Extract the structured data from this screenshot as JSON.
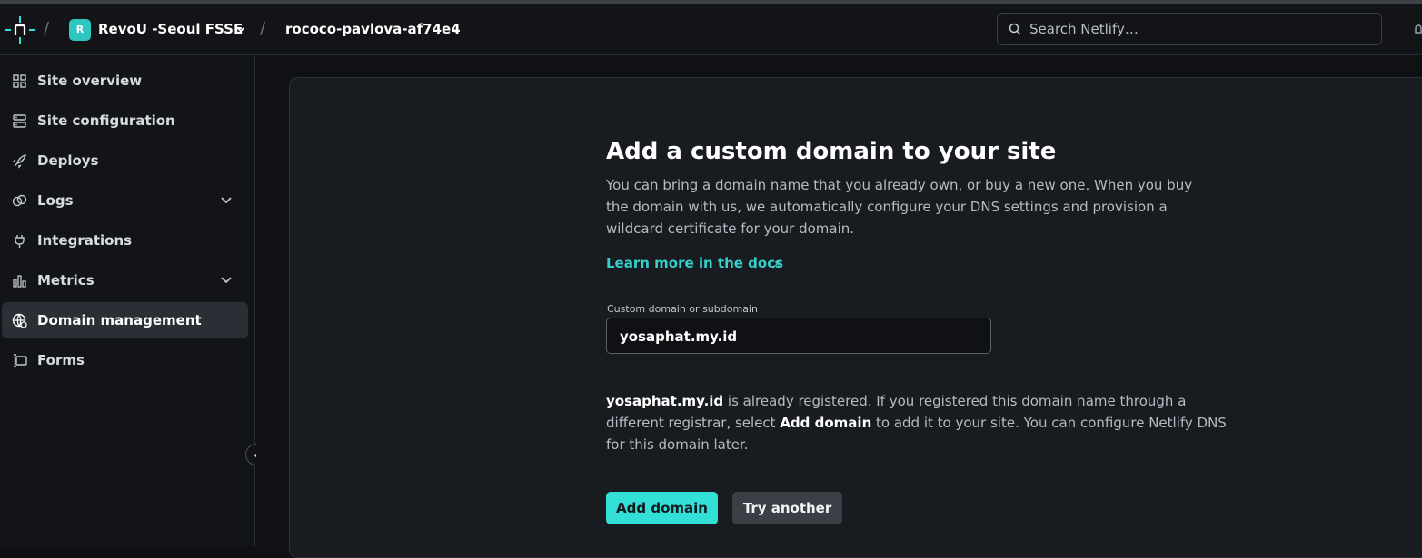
{
  "header": {
    "team_initial": "R",
    "team_name": "RevoU -Seoul FSSE",
    "site_name": "rococo-pavlova-af74e4",
    "search_placeholder": "Search Netlify…"
  },
  "sidebar": {
    "items": [
      {
        "label": "Site overview",
        "icon": "grid-icon"
      },
      {
        "label": "Site configuration",
        "icon": "settings-list-icon"
      },
      {
        "label": "Deploys",
        "icon": "rocket-icon"
      },
      {
        "label": "Logs",
        "icon": "coins-icon",
        "expandable": true
      },
      {
        "label": "Integrations",
        "icon": "plug-icon"
      },
      {
        "label": "Metrics",
        "icon": "bar-chart-icon",
        "expandable": true
      },
      {
        "label": "Domain management",
        "icon": "globe-gear-icon",
        "active": true
      },
      {
        "label": "Forms",
        "icon": "form-icon"
      }
    ]
  },
  "main": {
    "title": "Add a custom domain to your site",
    "description": "You can bring a domain name that you already own, or buy a new one. When you buy the domain with us, we automatically configure your DNS settings and provision a wildcard certificate for your domain.",
    "docs_link": "Learn more in the docs",
    "field_label": "Custom domain or subdomain",
    "field_value": "yosaphat.my.id",
    "note": {
      "domain": "yosaphat.my.id",
      "text1": " is already registered. If you registered this domain name through a different registrar, select ",
      "action": "Add domain",
      "text2": " to add it to your site. You can configure Netlify DNS for this domain later."
    },
    "primary_button": "Add domain",
    "secondary_button": "Try another"
  },
  "colors": {
    "accent": "#32e0d8",
    "link": "#35d0cb",
    "background": "#0f1114",
    "card": "#181b1f"
  }
}
